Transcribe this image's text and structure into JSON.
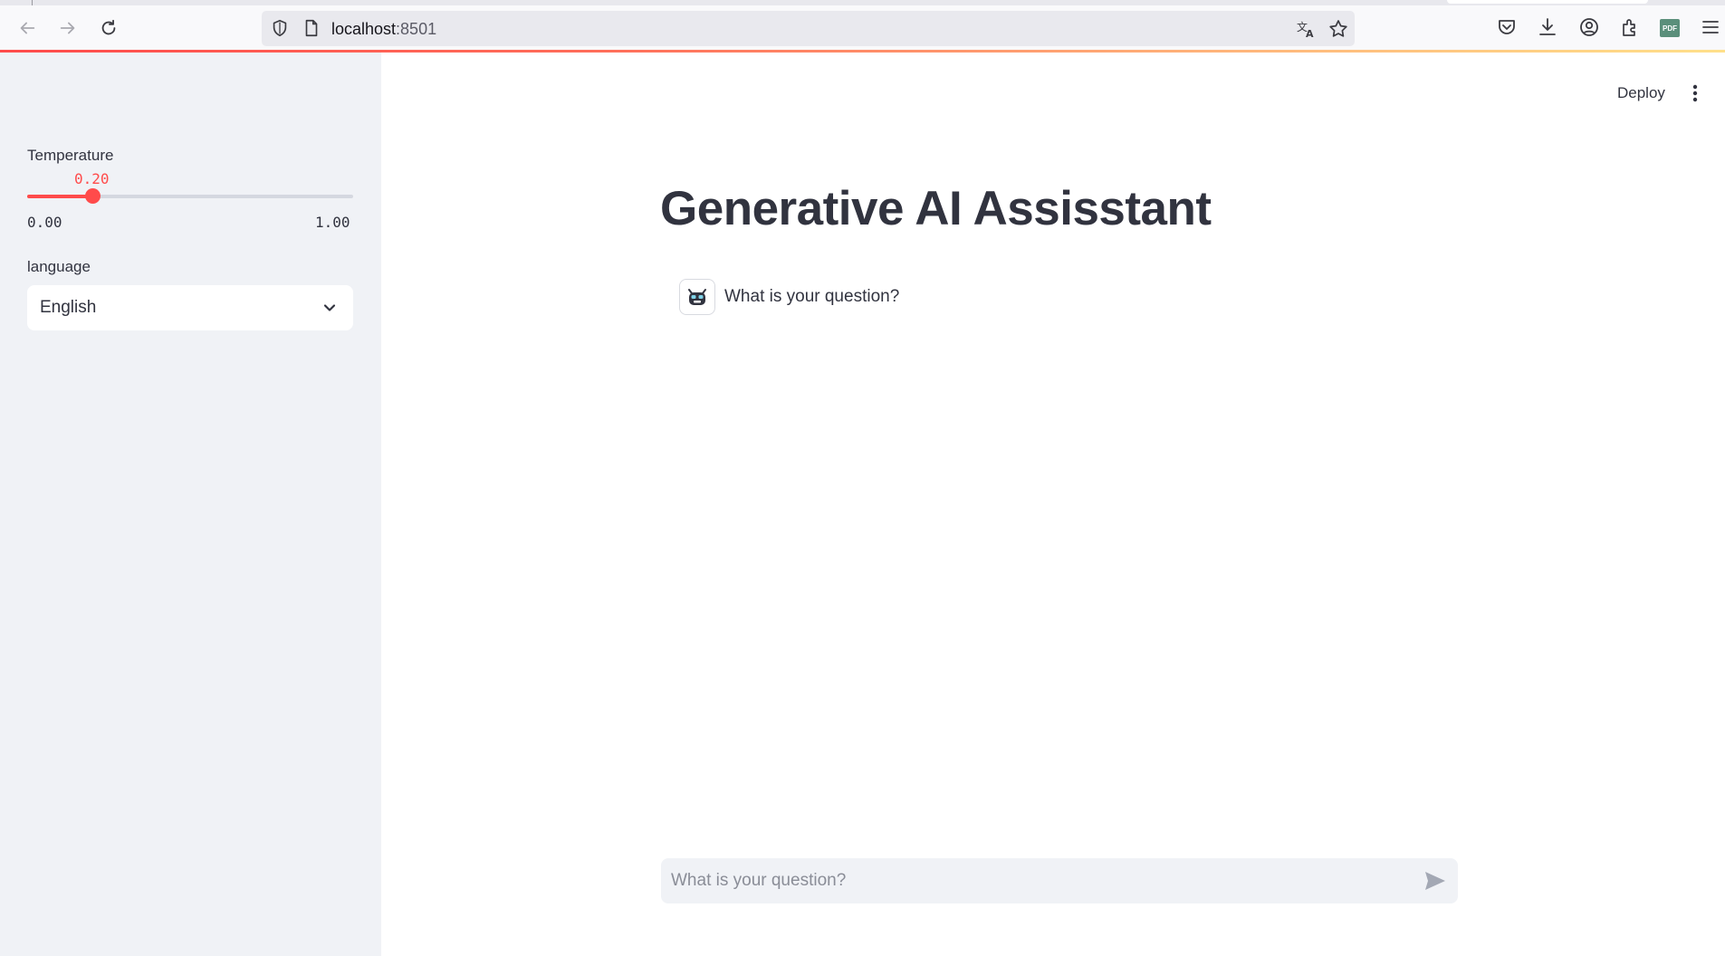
{
  "browser": {
    "url_host": "localhost",
    "url_port": ":8501",
    "pdf_badge": "PDF"
  },
  "sidebar": {
    "temperature": {
      "label": "Temperature",
      "value_text": "0.20",
      "value": 0.2,
      "min_text": "0.00",
      "max_text": "1.00",
      "min": 0.0,
      "max": 1.0
    },
    "language": {
      "label": "language",
      "selected": "English"
    }
  },
  "header": {
    "deploy_label": "Deploy"
  },
  "main": {
    "title": "Generative AI Assisstant",
    "message": "What is your question?",
    "chat_placeholder": "What is your question?"
  },
  "colors": {
    "accent": "#ff4b4b",
    "sidebar_bg": "#f0f2f6",
    "text": "#31333f"
  }
}
